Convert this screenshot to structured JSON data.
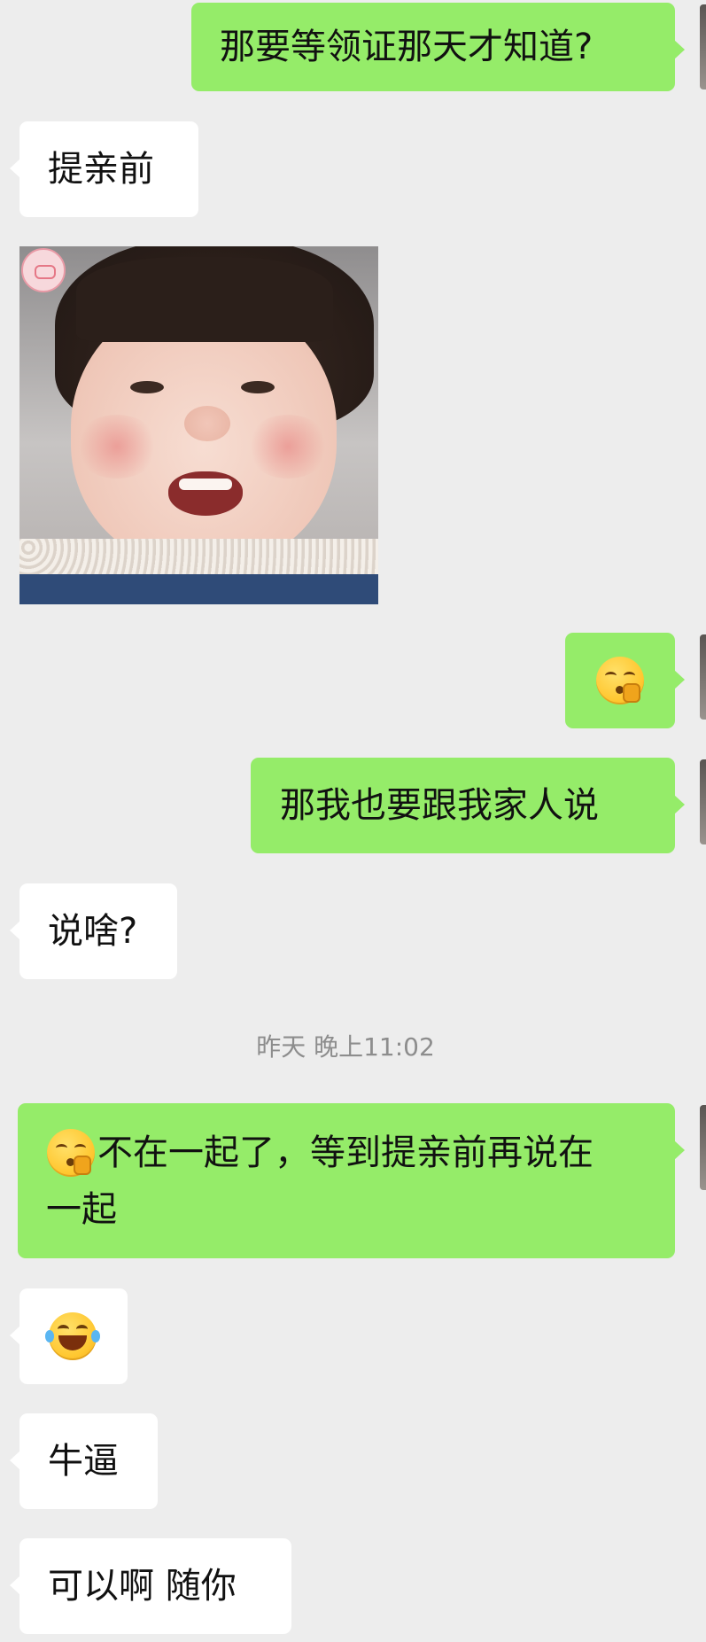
{
  "messages": [
    {
      "side": "out",
      "text": "那要等领证那天才知道?"
    },
    {
      "side": "in",
      "text": "提亲前"
    },
    {
      "side": "in",
      "type": "image",
      "alt": "sticker photo"
    },
    {
      "side": "out",
      "emoji": "shush-face-icon"
    },
    {
      "side": "out",
      "text": "那我也要跟我家人说"
    },
    {
      "side": "in",
      "text": "说啥?"
    },
    {
      "side": "out",
      "emoji": "shush-face-icon",
      "line1": "不在一起了，等到提亲前再说在",
      "line2": "一起"
    },
    {
      "side": "in",
      "emoji": "tears-of-joy-icon"
    },
    {
      "side": "in",
      "text": "牛逼"
    },
    {
      "side": "in",
      "text": "可以啊 随你"
    }
  ],
  "timestamp": "昨天 晚上11:02",
  "colors": {
    "background": "#ededed",
    "incoming_bubble": "#ffffff",
    "outgoing_bubble": "#95ec69",
    "timestamp_text": "#8d8d8d"
  }
}
